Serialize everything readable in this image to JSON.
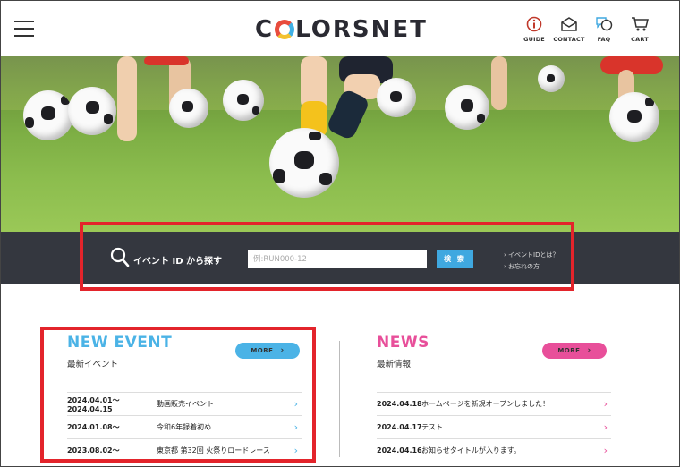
{
  "header": {
    "logo": "COLORSNET",
    "nav": [
      {
        "label": "GUIDE",
        "icon": "info-icon"
      },
      {
        "label": "CONTACT",
        "icon": "mail-icon"
      },
      {
        "label": "FAQ",
        "icon": "chat-icon"
      },
      {
        "label": "CART",
        "icon": "cart-icon"
      }
    ]
  },
  "search": {
    "title": "イベント ID から探す",
    "placeholder": "例:RUN000-12",
    "button": "検 索",
    "links": [
      "イベントIDとは？",
      "お忘れの方"
    ]
  },
  "new_event": {
    "title": "NEW EVENT",
    "subtitle": "最新イベント",
    "more": "MORE",
    "accent": "#4bb3e6",
    "items": [
      {
        "date": "2024.04.01～2024.04.15",
        "name": "動画販売イベント"
      },
      {
        "date": "2024.01.08～",
        "name": "令和6年録着初め"
      },
      {
        "date": "2023.08.02～",
        "name": "東京都 第32回 火祭りロードレース"
      }
    ]
  },
  "news": {
    "title": "NEWS",
    "subtitle": "最新情報",
    "more": "MORE",
    "accent": "#e84f9a",
    "items": [
      {
        "date": "2024.04.18",
        "name": "ホームページを新規オープンしました！"
      },
      {
        "date": "2024.04.17",
        "name": "テスト"
      },
      {
        "date": "2024.04.16",
        "name": "お知らせタイトルが入ります。"
      }
    ]
  },
  "colors": {
    "highlight": "#e3242b",
    "search_bg": "#34373f",
    "search_button": "#3fa8e0"
  }
}
